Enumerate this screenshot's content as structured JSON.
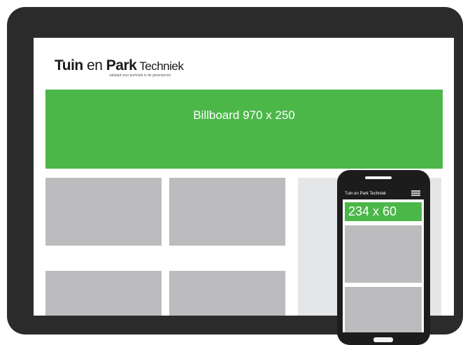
{
  "site": {
    "logo_bold_1": "Tuin",
    "logo_text_1": " en ",
    "logo_bold_2": "Park",
    "logo_text_2": " Techniek",
    "tagline": "vakblad voor techniek in de groensector"
  },
  "billboard": {
    "label": "Billboard 970 x 250"
  },
  "mobile": {
    "header_title": "Tuin en Park Techniek",
    "ad_label": "234 x 60",
    "menu_icon": "hamburger-menu-icon"
  },
  "colors": {
    "ad_green": "#4cb749",
    "placeholder_gray": "#bcbcbe",
    "sidebar_gray": "#e5e6e8",
    "device_frame": "#2b2b2b"
  }
}
